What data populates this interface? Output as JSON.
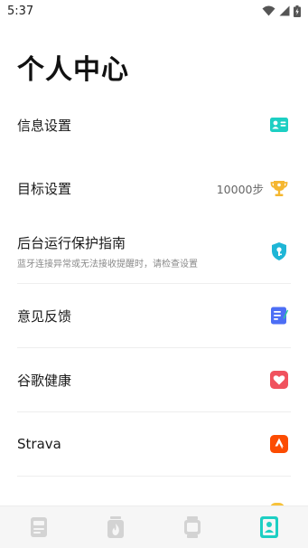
{
  "status_bar": {
    "time": "5:37",
    "icons": [
      "wifi-icon",
      "cellular-signal-icon",
      "battery-charging-icon"
    ]
  },
  "page": {
    "title": "个人中心"
  },
  "menu": [
    {
      "label": "信息设置",
      "icon": "profile-card-icon",
      "icon_color": "#1dcfc3"
    },
    {
      "label": "目标设置",
      "value": "10000步",
      "icon": "trophy-icon",
      "icon_color": "#f5b730"
    },
    {
      "label": "后台运行保护指南",
      "subtitle": "蓝牙连接异常或无法接收提醒时，请检查设置",
      "icon": "shield-icon",
      "icon_color": "#1fb6d6"
    },
    {
      "label": "意见反馈",
      "icon": "feedback-note-icon",
      "icon_color": "#4c6ef5"
    },
    {
      "label": "谷歌健康",
      "icon": "heart-icon",
      "icon_color": "#f0525e"
    },
    {
      "label": "Strava",
      "icon": "strava-icon",
      "icon_color": "#fc4c02"
    }
  ],
  "tab_bar": {
    "active_color": "#1dcfc3",
    "inactive_color": "#d3d3d3",
    "tabs": [
      {
        "icon": "dashboard-icon",
        "active": false
      },
      {
        "icon": "flame-icon",
        "active": false
      },
      {
        "icon": "watch-device-icon",
        "active": false
      },
      {
        "icon": "profile-icon",
        "active": true
      }
    ]
  }
}
